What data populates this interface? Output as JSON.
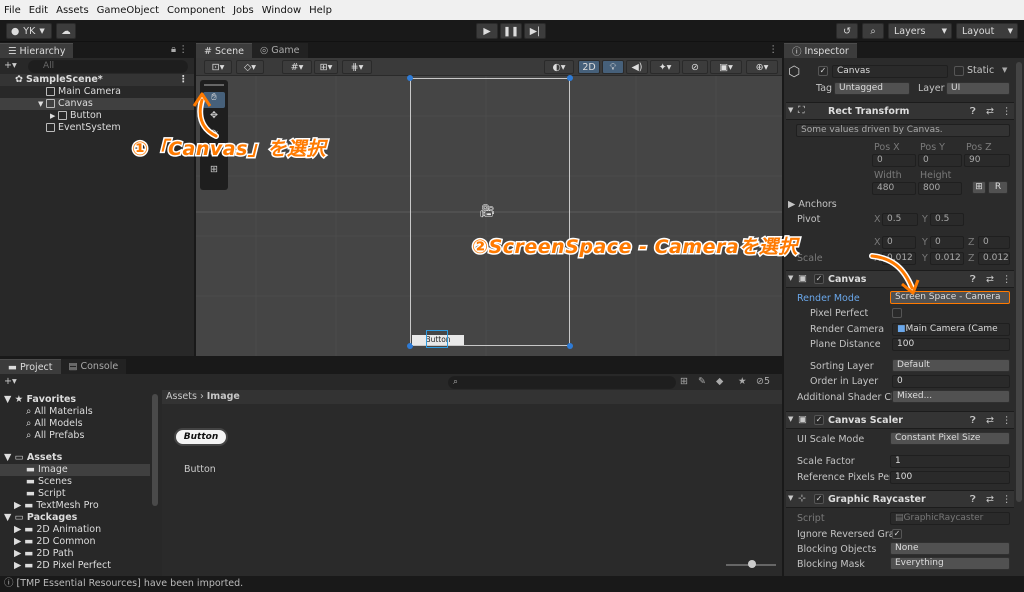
{
  "menu": [
    "File",
    "Edit",
    "Assets",
    "GameObject",
    "Component",
    "Jobs",
    "Window",
    "Help"
  ],
  "toolbar": {
    "account": "YK",
    "layers": "Layers",
    "layout": "Layout"
  },
  "hierarchy": {
    "tab": "Hierarchy",
    "search_placeholder": "All",
    "scene": "SampleScene*",
    "items": [
      "Main Camera",
      "Canvas",
      "Button",
      "EventSystem"
    ]
  },
  "scene": {
    "tab_scene": "Scene",
    "tab_game": "Game",
    "mode_2d": "2D",
    "button_label": "Button"
  },
  "project": {
    "tab_project": "Project",
    "tab_console": "Console",
    "hidden_count": "5",
    "favorites": "Favorites",
    "fav_items": [
      "All Materials",
      "All Models",
      "All Prefabs"
    ],
    "assets": "Assets",
    "asset_items": [
      "Image",
      "Scenes",
      "Script",
      "TextMesh Pro"
    ],
    "packages": "Packages",
    "package_items": [
      "2D Animation",
      "2D Common",
      "2D Path",
      "2D Pixel Perfect"
    ],
    "breadcrumb_root": "Assets",
    "breadcrumb_leaf": "Image",
    "asset_thumb": "Button",
    "asset_name": "Button"
  },
  "status": "[TMP Essential Resources] have been imported.",
  "inspector": {
    "tab": "Inspector",
    "object_name": "Canvas",
    "static_label": "Static",
    "tag_label": "Tag",
    "tag_value": "Untagged",
    "layer_label": "Layer",
    "layer_value": "UI",
    "rect": {
      "title": "Rect Transform",
      "note": "Some values driven by Canvas.",
      "posx_l": "Pos X",
      "posy_l": "Pos Y",
      "posz_l": "Pos Z",
      "posx": "0",
      "posy": "0",
      "posz": "90",
      "width_l": "Width",
      "height_l": "Height",
      "width": "480",
      "height": "800",
      "r_btn": "R",
      "anchors": "Anchors",
      "pivot": "Pivot",
      "pivot_x": "0.5",
      "pivot_y": "0.5",
      "rot_x": "0",
      "rot_y": "0",
      "rot_z": "0",
      "scale_label": "Scale",
      "scale_x": "0.012",
      "scale_y": "0.012",
      "scale_z": "0.012",
      "xl": "X",
      "yl": "Y",
      "zl": "Z"
    },
    "canvas": {
      "title": "Canvas",
      "render_mode_l": "Render Mode",
      "render_mode": "Screen Space - Camera",
      "pixel_perfect_l": "Pixel Perfect",
      "render_camera_l": "Render Camera",
      "render_camera": "Main Camera (Came",
      "plane_distance_l": "Plane Distance",
      "plane_distance": "100",
      "sorting_layer_l": "Sorting Layer",
      "sorting_layer": "Default",
      "order_l": "Order in Layer",
      "order": "0",
      "shader_l": "Additional Shader Ch",
      "shader": "Mixed..."
    },
    "scaler": {
      "title": "Canvas Scaler",
      "ui_scale_l": "UI Scale Mode",
      "ui_scale": "Constant Pixel Size",
      "scale_factor_l": "Scale Factor",
      "scale_factor": "1",
      "ref_ppu_l": "Reference Pixels Per",
      "ref_ppu": "100"
    },
    "raycaster": {
      "title": "Graphic Raycaster",
      "script_l": "Script",
      "script": "GraphicRaycaster",
      "ignore_l": "Ignore Reversed Gra",
      "blocking_obj_l": "Blocking Objects",
      "blocking_obj": "None",
      "blocking_mask_l": "Blocking Mask",
      "blocking_mask": "Everything"
    }
  },
  "annotations": {
    "step1": "①「Canvas」を選択",
    "step2": "②ScreenSpace - Cameraを選択"
  },
  "colors": {
    "accent": "#ff7a00",
    "selection": "#2c5d87",
    "link": "#5fa0e8"
  }
}
